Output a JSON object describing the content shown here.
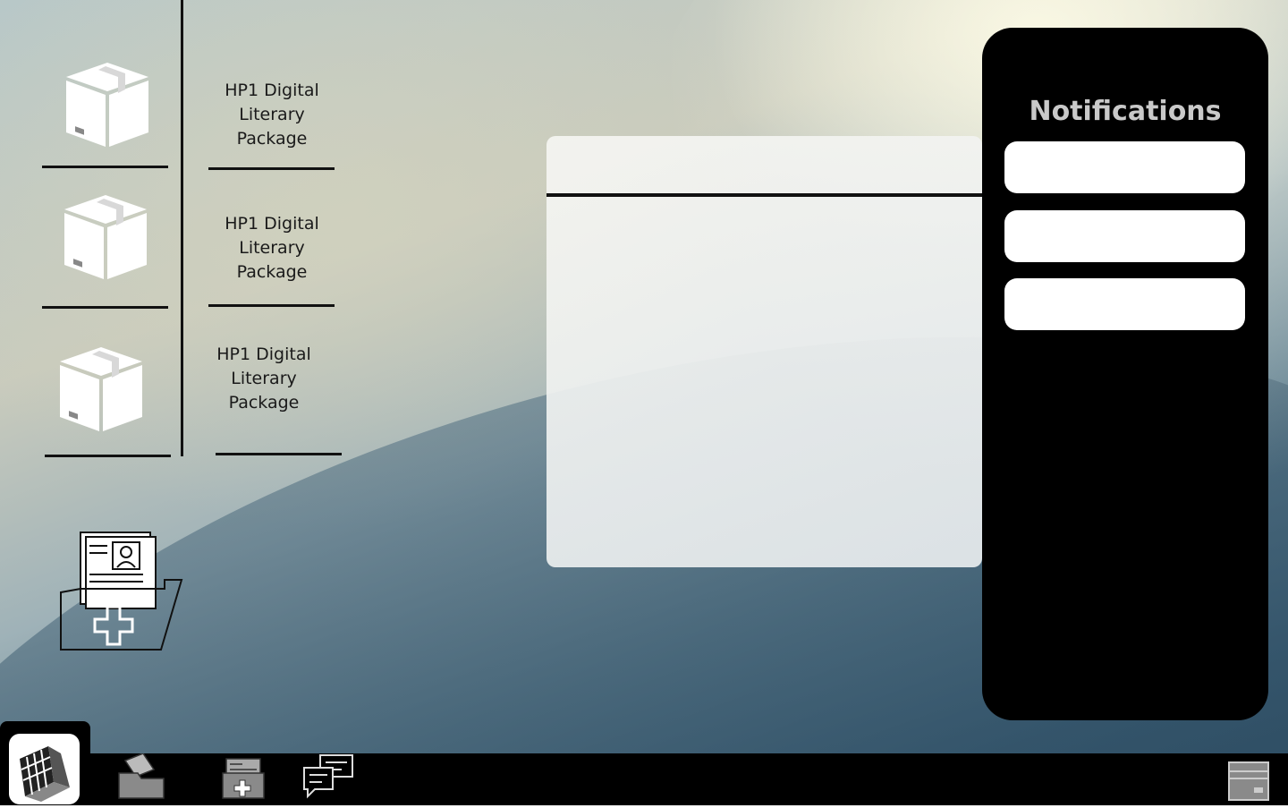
{
  "desktop": {
    "packages": [
      {
        "label": "HP1 Digital Literary Package",
        "icon": "package-box-icon"
      },
      {
        "label": "HP1 Digital Literary Package",
        "icon": "package-box-icon"
      },
      {
        "label": "HP1 Digital Literary Package",
        "icon": "package-box-icon"
      }
    ],
    "folder_icon": "medical-records-folder-icon"
  },
  "notifications": {
    "title": "Notifications",
    "title_color": "#c9c9c9",
    "items": [
      "",
      "",
      ""
    ]
  },
  "taskbar": {
    "start_icon": "app-logo-icon",
    "items": [
      {
        "name": "files-icon"
      },
      {
        "name": "medical-records-icon"
      },
      {
        "name": "chat-icon"
      }
    ],
    "tray_icon": "window-panel-icon"
  },
  "colors": {
    "panel": "#000000",
    "card": "#ffffff",
    "text": "#1a1a1a"
  }
}
